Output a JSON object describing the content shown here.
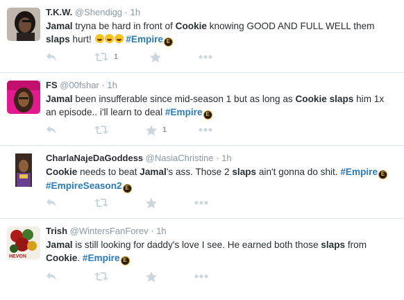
{
  "tweets": [
    {
      "fullname": "T.K.W.",
      "username": "@Shendigg",
      "time": "1h",
      "text": [
        {
          "t": "Jamal",
          "b": true
        },
        {
          "t": " tryna be hard in front of "
        },
        {
          "t": "Cookie",
          "b": true
        },
        {
          "t": " knowing GOOD AND FULL WELL them "
        },
        {
          "t": "slaps",
          "b": true
        },
        {
          "t": " hurt! "
        },
        {
          "emoji": "laugh"
        },
        {
          "emoji": "laugh"
        },
        {
          "emoji": "laugh"
        },
        {
          "t": " "
        },
        {
          "tag": "#Empire"
        },
        {
          "emoji": "empire"
        }
      ],
      "counts": {
        "reply": "",
        "retweet": "1",
        "favorite": ""
      }
    },
    {
      "fullname": "FS",
      "username": "@00fshar",
      "time": "1h",
      "text": [
        {
          "t": "Jamal",
          "b": true
        },
        {
          "t": " been insufferable since mid-season 1 but as long as "
        },
        {
          "t": "Cookie",
          "b": true
        },
        {
          "t": " "
        },
        {
          "t": "slaps",
          "b": true
        },
        {
          "t": " him 1x an episode.. i'll learn to deal "
        },
        {
          "tag": "#Empire"
        },
        {
          "emoji": "empire"
        }
      ],
      "counts": {
        "reply": "",
        "retweet": "",
        "favorite": "1"
      }
    },
    {
      "fullname": "CharlaNajeDaGoddess",
      "username": "@NasiaChristine",
      "time": "1h",
      "text": [
        {
          "t": "Cookie",
          "b": true
        },
        {
          "t": " needs to beat "
        },
        {
          "t": "Jamal",
          "b": true
        },
        {
          "t": "'s ass. Those 2 "
        },
        {
          "t": "slaps",
          "b": true
        },
        {
          "t": " ain't gonna do shit. "
        },
        {
          "tag": "#Empire"
        },
        {
          "emoji": "empire"
        },
        {
          "t": " "
        },
        {
          "tag": "#EmpireSeason2"
        },
        {
          "emoji": "empire"
        }
      ],
      "counts": {
        "reply": "",
        "retweet": "",
        "favorite": ""
      }
    },
    {
      "fullname": "Trish",
      "username": "@WintersFanForev",
      "time": "1h",
      "text": [
        {
          "t": "Jamal",
          "b": true
        },
        {
          "t": " is still looking for daddy's love I see. He earned both those "
        },
        {
          "t": "slaps",
          "b": true
        },
        {
          "t": " from "
        },
        {
          "t": "Cookie",
          "b": true
        },
        {
          "t": ". "
        },
        {
          "tag": "#Empire"
        },
        {
          "emoji": "empire"
        }
      ],
      "counts": {
        "reply": "",
        "retweet": "",
        "favorite": ""
      }
    }
  ],
  "avatar_labels": [
    "",
    "",
    "",
    "HEVON"
  ],
  "emoji_glyphs": {
    "empire": "E"
  },
  "colors": {
    "hashtag": "#2b7bb9",
    "muted": "#8899a6",
    "icon": "#ccd6dd"
  },
  "icons": [
    "reply-icon",
    "retweet-icon",
    "favorite-icon",
    "more-icon"
  ]
}
